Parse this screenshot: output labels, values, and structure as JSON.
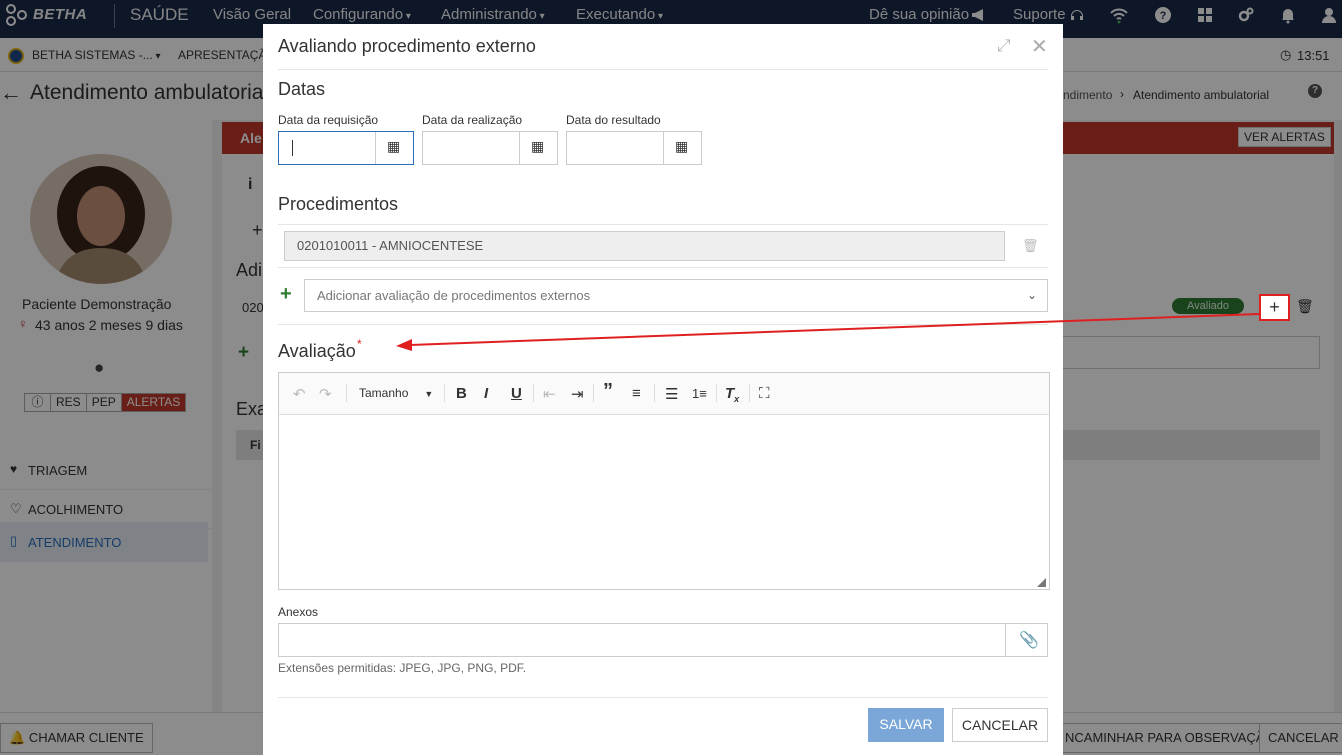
{
  "topbar": {
    "brand": "BETHA",
    "product": "SAÚDE",
    "nav": [
      "Visão Geral",
      "Configurando",
      "Administrando",
      "Executando"
    ],
    "feedback": "Dê sua opinião",
    "support": "Suporte"
  },
  "subbar": {
    "org": "BETHA SISTEMAS -...",
    "entity": "APRESENTAÇÃ",
    "time": "13:51"
  },
  "titlebar": {
    "title": "Atendimento ambulatorial",
    "breadcrumb": "ndimento",
    "breadcrumb_current": "Atendimento ambulatorial"
  },
  "patient": {
    "name": "Paciente Demonstração",
    "age": "43 anos 2 meses 9 dias",
    "tags": [
      "RES",
      "PEP",
      "ALERTAS"
    ]
  },
  "sidebar": {
    "items": [
      "TRIAGEM",
      "ACOLHIMENTO",
      "ATENDIMENTO"
    ]
  },
  "background": {
    "alert_prefix": "Ale",
    "ver_alertas": "VER ALERTAS",
    "heading_add": "Adi",
    "row_code": "020",
    "exam_heading": "Exa",
    "table_header": "Fi",
    "badge": "Avaliado"
  },
  "footer": {
    "call": "CHAMAR CLIENTE",
    "forward": "NCAMINHAR PARA OBSERVAÇÃO",
    "cancel": "CANCELAR"
  },
  "modal": {
    "title": "Avaliando procedimento externo",
    "dates_section": "Datas",
    "date_labels": [
      "Data da requisição",
      "Data da realização",
      "Data do resultado"
    ],
    "procedures_section": "Procedimentos",
    "procedure_item": "0201010011 - AMNIOCENTESE",
    "add_placeholder": "Adicionar avaliação de procedimentos externos",
    "evaluation_section": "Avaliação",
    "required_mark": "*",
    "size_label": "Tamanho",
    "attachments_label": "Anexos",
    "extensions_hint": "Extensões permitidas: JPEG, JPG, PNG, PDF.",
    "save": "SALVAR",
    "cancel": "CANCELAR"
  },
  "colors": {
    "topbar": "#1a2a4a",
    "alert": "#c0392b",
    "primary": "#7aa7d8",
    "badge": "#2e7d32",
    "annotation": "#e02020"
  }
}
